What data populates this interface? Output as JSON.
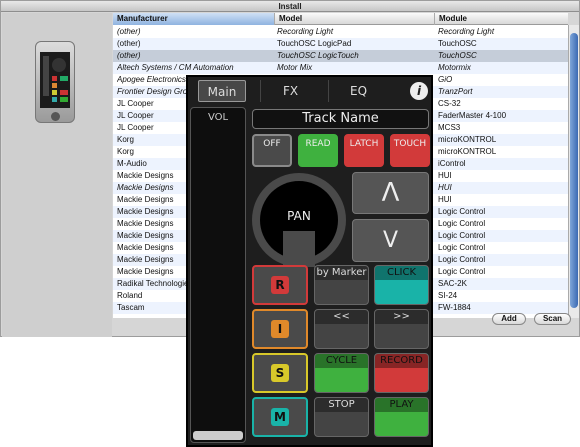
{
  "window": {
    "title": "Install"
  },
  "table": {
    "headers": [
      "Manufacturer",
      "Model",
      "Module"
    ],
    "rows": [
      {
        "manufacturer": "(other)",
        "model": "Recording Light",
        "module": "Recording Light",
        "italic": true
      },
      {
        "manufacturer": "(other)",
        "model": "TouchOSC LogicPad",
        "module": "TouchOSC",
        "italic": false
      },
      {
        "manufacturer": "(other)",
        "model": "TouchOSC LogicTouch",
        "module": "TouchOSC",
        "italic": true,
        "selected": true
      },
      {
        "manufacturer": "Altech Systems / CM Automation",
        "model": "Motor Mix",
        "module": "Motormix",
        "italic": true
      },
      {
        "manufacturer": "Apogee Electronics",
        "model": "",
        "module": "GiO",
        "italic": true
      },
      {
        "manufacturer": "Frontier Design Gro",
        "model": "",
        "module": "TranzPort",
        "italic": true
      },
      {
        "manufacturer": "JL Cooper",
        "model": "",
        "module": "CS-32",
        "italic": false
      },
      {
        "manufacturer": "JL Cooper",
        "model": "",
        "module": "FaderMaster 4-100",
        "italic": false
      },
      {
        "manufacturer": "JL Cooper",
        "model": "",
        "module": "MCS3",
        "italic": false
      },
      {
        "manufacturer": "Korg",
        "model": "",
        "module": "microKONTROL",
        "italic": false
      },
      {
        "manufacturer": "Korg",
        "model": "",
        "module": "microKONTROL",
        "italic": false
      },
      {
        "manufacturer": "M-Audio",
        "model": "",
        "module": "iControl",
        "italic": false
      },
      {
        "manufacturer": "Mackie Designs",
        "model": "",
        "module": "HUI",
        "italic": false
      },
      {
        "manufacturer": "Mackie Designs",
        "model": "",
        "module": "HUI",
        "italic": true
      },
      {
        "manufacturer": "Mackie Designs",
        "model": "",
        "module": "HUI",
        "italic": false
      },
      {
        "manufacturer": "Mackie Designs",
        "model": "",
        "module": "Logic Control",
        "italic": false
      },
      {
        "manufacturer": "Mackie Designs",
        "model": "",
        "module": "Logic Control",
        "italic": false
      },
      {
        "manufacturer": "Mackie Designs",
        "model": "",
        "module": "Logic Control",
        "italic": false
      },
      {
        "manufacturer": "Mackie Designs",
        "model": "",
        "module": "Logic Control",
        "italic": false
      },
      {
        "manufacturer": "Mackie Designs",
        "model": "",
        "module": "Logic Control",
        "italic": false
      },
      {
        "manufacturer": "Mackie Designs",
        "model": "",
        "module": "Logic Control",
        "italic": false
      },
      {
        "manufacturer": "Radikal Technologie",
        "model": "",
        "module": "SAC-2K",
        "italic": false
      },
      {
        "manufacturer": "Roland",
        "model": "",
        "module": "SI-24",
        "italic": false
      },
      {
        "manufacturer": "Tascam",
        "model": "",
        "module": "FW-1884",
        "italic": false
      }
    ]
  },
  "buttons": {
    "add": "Add",
    "scan": "Scan"
  },
  "osc": {
    "tabs": [
      "Main",
      "FX",
      "EQ"
    ],
    "info": "i",
    "vol_label": "VOL",
    "track_name": "Track Name",
    "automation": [
      {
        "label": "OFF",
        "color": "#8a8a8a"
      },
      {
        "label": "READ",
        "color": "#3fb13f"
      },
      {
        "label": "LATCH",
        "color": "#d23a3a"
      },
      {
        "label": "TOUCH",
        "color": "#d23a3a"
      }
    ],
    "pan_label": "PAN",
    "up_arrow": "Λ",
    "down_arrow": "V",
    "rows": [
      {
        "btn": "R",
        "btn_color": "#d23a3a",
        "left": "by Marker",
        "right": "CLICK",
        "right_color": "#19b3a8"
      },
      {
        "btn": "I",
        "btn_color": "#e0892a",
        "left": "<<",
        "right": ">>",
        "right_color": "#8a8a8a"
      },
      {
        "btn": "S",
        "btn_color": "#d8c82a",
        "left": "CYCLE",
        "right": "RECORD",
        "right_color": "#d23a3a"
      },
      {
        "btn": "M",
        "btn_color": "#19b3a8",
        "left": "STOP",
        "right": "PLAY",
        "right_color": "#3fb13f"
      }
    ],
    "left_colors": [
      "#8a8a8a",
      "#8a8a8a",
      "#3fb13f",
      "#8a8a8a"
    ]
  }
}
